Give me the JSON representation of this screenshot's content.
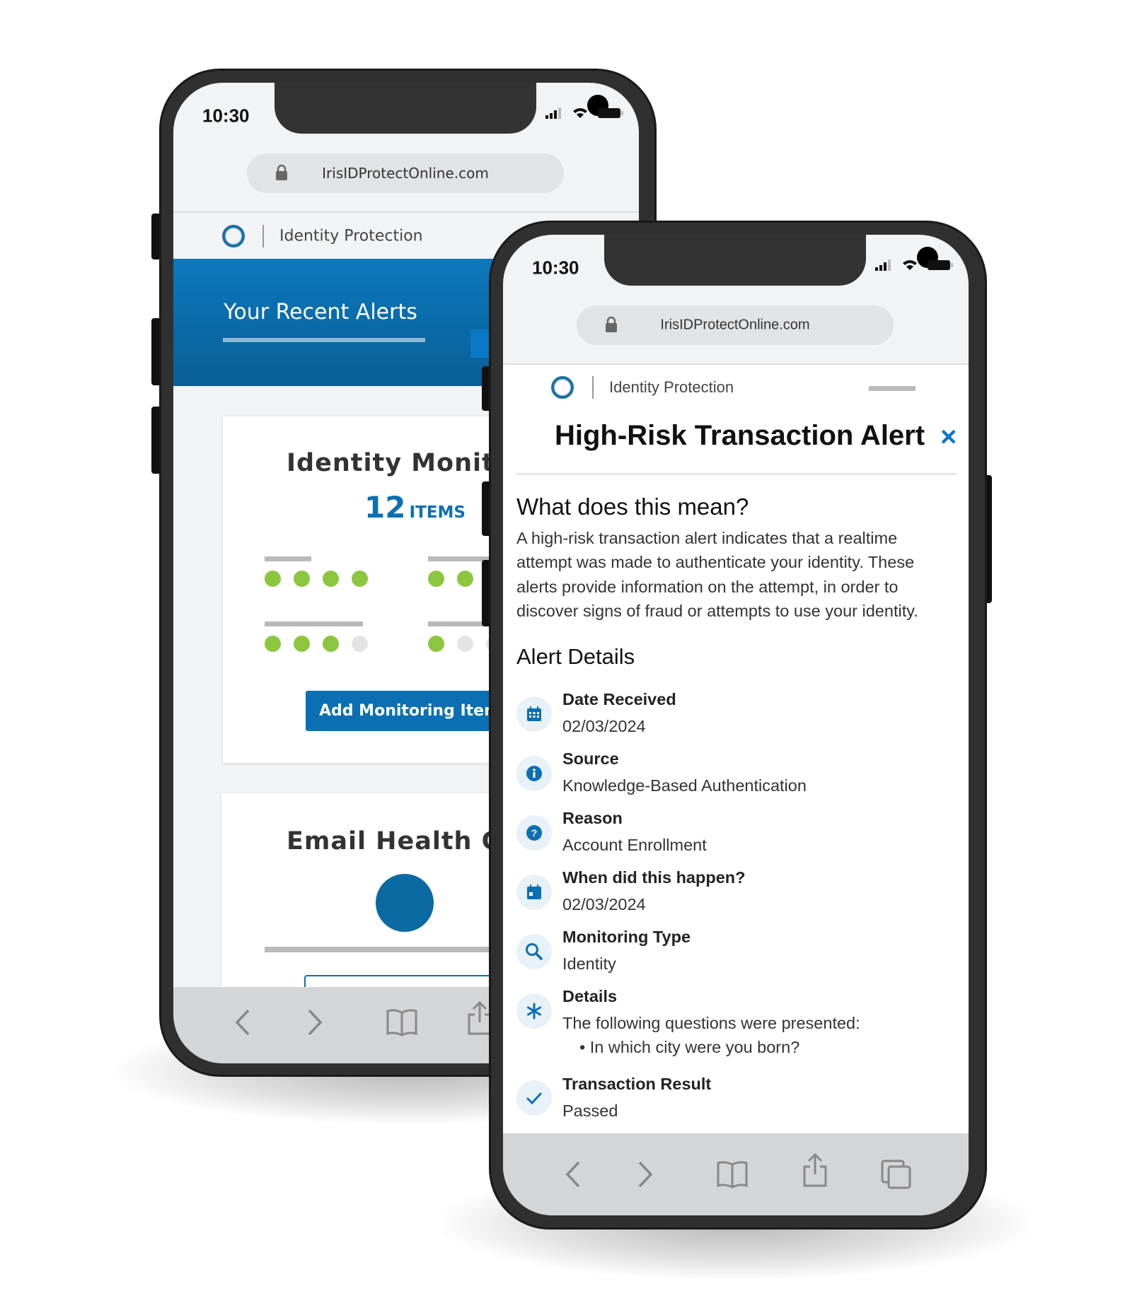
{
  "colors": {
    "brand_blue": "#0b6fb3",
    "green": "#8cc63f",
    "inactive_dot": "#e4e4e4",
    "toolbar": "#d4d5d7"
  },
  "back_phone": {
    "status": {
      "time": "10:30",
      "icons": [
        "signal-icon",
        "wifi-icon",
        "battery-icon"
      ]
    },
    "url": "IrisIDProtectOnline.com",
    "header": {
      "title": "Identity Protection"
    },
    "banner": {
      "title": "Your Recent Alerts"
    },
    "monitoring_card": {
      "title": "Identity Monitoring",
      "count": "12",
      "count_unit": "ITEMS",
      "groups": [
        {
          "dots": [
            true,
            true,
            true,
            true
          ]
        },
        {
          "dots": [
            true,
            true,
            true
          ]
        },
        {
          "dots": [
            true,
            true,
            true,
            false
          ]
        },
        {
          "dots": [
            true,
            false,
            false
          ]
        }
      ],
      "button": "Add Monitoring Items"
    },
    "email_card": {
      "title": "Email Health Check"
    },
    "toolbar": [
      "back-icon",
      "forward-icon",
      "bookmarks-icon",
      "share-icon"
    ]
  },
  "front_phone": {
    "status": {
      "time": "10:30",
      "icons": [
        "signal-icon",
        "wifi-icon",
        "battery-icon"
      ]
    },
    "url": "IrisIDProtectOnline.com",
    "header": {
      "title": "Identity Protection"
    },
    "alert": {
      "title": "High-Risk Transaction Alert",
      "close": "×",
      "meaning_heading": "What does this mean?",
      "meaning_text": "A high-risk transaction alert indicates that a realtime attempt was made to authenticate your identity. These alerts provide information on the attempt, in order to discover signs of fraud or attempts to use your identity.",
      "details_heading": "Alert Details",
      "details": [
        {
          "icon": "calendar-grid-icon",
          "label": "Date Received",
          "value": "02/03/2024"
        },
        {
          "icon": "info-icon",
          "label": "Source",
          "value": "Knowledge-Based Authentication"
        },
        {
          "icon": "question-icon",
          "label": "Reason",
          "value": "Account Enrollment"
        },
        {
          "icon": "calendar-icon",
          "label": "When did this happen?",
          "value": "02/03/2024"
        },
        {
          "icon": "search-icon",
          "label": "Monitoring Type",
          "value": "Identity"
        },
        {
          "icon": "asterisk-icon",
          "label": "Details",
          "value": "The following questions were presented:",
          "bullet": "In which city were you born?"
        },
        {
          "icon": "check-icon",
          "label": "Transaction Result",
          "value": "Passed"
        }
      ]
    },
    "toolbar": [
      "back-icon",
      "forward-icon",
      "bookmarks-icon",
      "share-icon",
      "tabs-icon"
    ]
  }
}
